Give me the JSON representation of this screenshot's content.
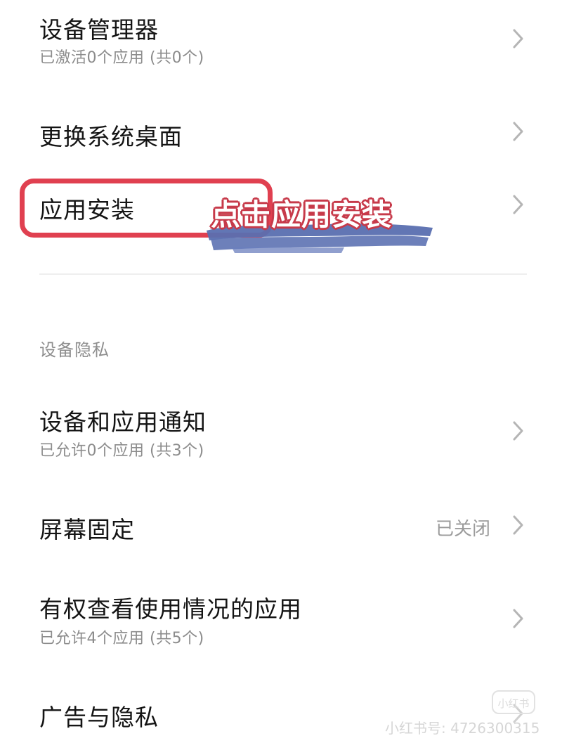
{
  "items": [
    {
      "title": "设备管理器",
      "subtitle": "已激活0个应用 (共0个)"
    },
    {
      "title": "更换系统桌面"
    },
    {
      "title": "应用安装"
    },
    {
      "title": "设备和应用通知",
      "subtitle": "已允许0个应用 (共3个)"
    },
    {
      "title": "屏幕固定",
      "value": "已关闭"
    },
    {
      "title": "有权查看使用情况的应用",
      "subtitle": "已允许4个应用 (共5个)"
    },
    {
      "title": "广告与隐私"
    }
  ],
  "section": {
    "device_privacy": "设备隐私"
  },
  "annotation": {
    "text": "点击应用安装",
    "box_color": "#e04050",
    "brush_color": "#5a6fb0"
  },
  "watermark": {
    "logo": "小红书",
    "text": "小红书号: 4726300315"
  },
  "icons": {
    "chevron": "chevron-right-icon"
  }
}
